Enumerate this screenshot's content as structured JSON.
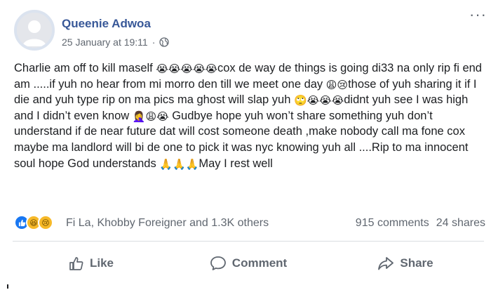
{
  "post": {
    "author": "Queenie Adwoa",
    "timestamp": "25 January at 19:11",
    "separator": "·",
    "privacy_icon": "globe-icon",
    "more_label": "···",
    "text": [
      {
        "t": "Charlie am off to kill maself "
      },
      {
        "e": "😭😭😭😭😭"
      },
      {
        "t": "cox de way de things is going di33 na only rip fi end am .....if yuh no hear from mi morro den till we meet one day "
      },
      {
        "e": "😩😢"
      },
      {
        "t": "those of yuh sharing it if I die and yuh type rip on ma pics ma ghost will slap yuh "
      },
      {
        "e": "🙄😭😭😭"
      },
      {
        "t": "didnt yuh see I was high and I didn’t even know "
      },
      {
        "e": "🤦‍♀️😩😭"
      },
      {
        "t": " Gudbye hope yuh won’t share something yuh don’t understand if de near future dat will cost someone death ,make nobody call ma fone cox maybe ma landlord will bi de one to pick it was nyc knowing yuh all ....Rip to ma innocent soul hope God understands "
      },
      {
        "e": "🙏🙏🙏"
      },
      {
        "t": "May I rest well"
      }
    ]
  },
  "reactions": {
    "icons": [
      "like-icon",
      "haha-icon",
      "sad-icon"
    ],
    "names": "Fi La, Khobby Foreigner and 1.3K others",
    "comments": "915 comments",
    "shares": "24 shares"
  },
  "actions": {
    "like": "Like",
    "comment": "Comment",
    "share": "Share"
  },
  "colors": {
    "author": "#385898",
    "meta": "#606770",
    "like_blue": "#1877f2",
    "reaction_yellow": "#f7b928"
  }
}
